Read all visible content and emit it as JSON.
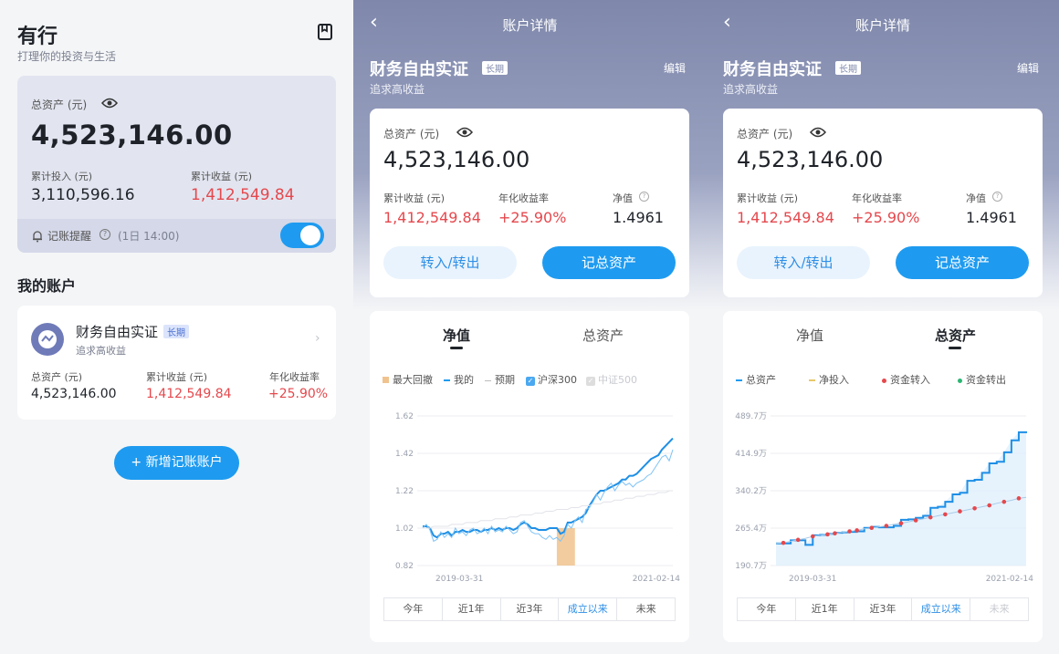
{
  "home": {
    "title": "有行",
    "subtitle": "打理你的投资与生活",
    "bookmark_icon": "bookmark-icon",
    "assets_label": "总资产 (元)",
    "assets_value": "4,523,146.00",
    "invest_label": "累计投入 (元)",
    "invest_value": "3,110,596.16",
    "income_label": "累计收益 (元)",
    "income_value": "1,412,549.84",
    "reminder_label": "记账提醒",
    "reminder_time": "(1日 14:00)",
    "reminder_on": true,
    "my_accounts": "我的账户",
    "account": {
      "name": "财务自由实证",
      "tag": "长期",
      "desc": "追求高收益",
      "assets_label": "总资产 (元)",
      "assets_value": "4,523,146.00",
      "income_label": "累计收益 (元)",
      "income_value": "1,412,549.84",
      "rate_label": "年化收益率",
      "rate_value": "+25.90%"
    },
    "add_button": "+ 新增记账账户"
  },
  "detail": {
    "nav_title": "账户详情",
    "account_name": "财务自由实证",
    "tag": "长期",
    "desc": "追求高收益",
    "edit": "编辑",
    "assets_label": "总资产 (元)",
    "assets_value": "4,523,146.00",
    "income_label": "累计收益 (元)",
    "income_value": "1,412,549.84",
    "rate_label": "年化收益率",
    "rate_value": "+25.90%",
    "nav_label": "净值",
    "nav_value": "1.4961",
    "transfer_button": "转入/转出",
    "record_button": "记总资产",
    "tab_nav": "净值",
    "tab_assets": "总资产",
    "ranges": [
      "今年",
      "近1年",
      "近3年",
      "成立以来",
      "未来"
    ]
  },
  "legend_nav": [
    "最大回撤",
    "我的",
    "预期",
    "沪深300",
    "中证500"
  ],
  "legend_assets": [
    "总资产",
    "净投入",
    "资金转入",
    "资金转出"
  ],
  "colors": {
    "accent": "#1e9bf0",
    "red": "#e5484d",
    "drawdown": "#f0c38e",
    "green": "#2bb673"
  },
  "chart_data": [
    {
      "type": "line",
      "title": "",
      "xlabel": "",
      "ylabel": "",
      "x_ticks": [
        "2019-03-31",
        "2021-02-14"
      ],
      "y_ticks": [
        "1.62",
        "1.42",
        "1.22",
        "1.02",
        "0.82"
      ],
      "ylim": [
        0.82,
        1.62
      ],
      "x": [
        0,
        1,
        2,
        3,
        4,
        5,
        6,
        7,
        8,
        9,
        10,
        11,
        12,
        13,
        14,
        15,
        16,
        17,
        18,
        19,
        20,
        21,
        22,
        23,
        24,
        25,
        26,
        27,
        28,
        29,
        30,
        31,
        32,
        33,
        34,
        35,
        36,
        37,
        38,
        39,
        40,
        41,
        42,
        43,
        44,
        45,
        46,
        47,
        48,
        49,
        50,
        51,
        52,
        53,
        54,
        55,
        56,
        57,
        58,
        59,
        60,
        61,
        62,
        63,
        64,
        65,
        66,
        67,
        68,
        69
      ],
      "series": [
        {
          "name": "我的",
          "values": [
            1.03,
            1.03,
            1.02,
            0.98,
            0.97,
            0.99,
            0.99,
            1.0,
            0.98,
            1.0,
            1.0,
            1.01,
            1.0,
            1.0,
            1.01,
            1.01,
            1.0,
            1.01,
            1.01,
            1.02,
            1.01,
            1.02,
            1.01,
            1.02,
            1.02,
            1.01,
            1.02,
            1.04,
            1.05,
            1.04,
            1.02,
            1.02,
            1.01,
            1.01,
            1.01,
            1.02,
            1.02,
            1.02,
            0.99,
            1.0,
            1.05,
            1.05,
            1.06,
            1.07,
            1.08,
            1.1,
            1.14,
            1.17,
            1.2,
            1.22,
            1.22,
            1.23,
            1.24,
            1.25,
            1.26,
            1.28,
            1.28,
            1.3,
            1.3,
            1.31,
            1.33,
            1.35,
            1.37,
            1.39,
            1.4,
            1.41,
            1.44,
            1.46,
            1.48,
            1.5
          ]
        },
        {
          "name": "沪深300",
          "values": [
            1.02,
            1.04,
            1.01,
            0.95,
            0.96,
            1.0,
            0.97,
            0.99,
            0.97,
            1.02,
            0.99,
            1.0,
            0.98,
            1.01,
            1.02,
            0.99,
            1.0,
            1.02,
            0.99,
            1.03,
            1.0,
            1.01,
            1.0,
            1.03,
            1.01,
            0.99,
            1.0,
            1.05,
            1.06,
            1.03,
            1.0,
            0.99,
            0.99,
            0.97,
            0.96,
            0.98,
            0.96,
            0.97,
            0.95,
            0.98,
            1.04,
            1.02,
            1.06,
            1.08,
            1.05,
            1.12,
            1.13,
            1.16,
            1.2,
            1.17,
            1.21,
            1.24,
            1.26,
            1.22,
            1.25,
            1.27,
            1.25,
            1.26,
            1.24,
            1.26,
            1.27,
            1.28,
            1.3,
            1.31,
            1.34,
            1.37,
            1.4,
            1.41,
            1.38,
            1.44
          ]
        },
        {
          "name": "预期",
          "values": [
            1.02,
            1.02,
            1.02,
            1.03,
            1.03,
            1.03,
            1.03,
            1.03,
            1.04,
            1.04,
            1.04,
            1.04,
            1.05,
            1.05,
            1.05,
            1.05,
            1.06,
            1.06,
            1.06,
            1.06,
            1.07,
            1.07,
            1.07,
            1.07,
            1.08,
            1.08,
            1.08,
            1.09,
            1.09,
            1.09,
            1.09,
            1.1,
            1.1,
            1.1,
            1.11,
            1.11,
            1.11,
            1.12,
            1.12,
            1.12,
            1.12,
            1.13,
            1.13,
            1.13,
            1.14,
            1.14,
            1.14,
            1.15,
            1.15,
            1.15,
            1.16,
            1.16,
            1.16,
            1.17,
            1.17,
            1.17,
            1.18,
            1.18,
            1.18,
            1.19,
            1.19,
            1.19,
            1.2,
            1.2,
            1.2,
            1.21,
            1.21,
            1.21,
            1.22,
            1.22
          ]
        }
      ],
      "drawdown_range": [
        37,
        42
      ]
    },
    {
      "type": "line",
      "title": "",
      "xlabel": "",
      "ylabel": "",
      "x_ticks": [
        "2019-03-31",
        "2021-02-14"
      ],
      "y_ticks": [
        "489.7万",
        "414.9万",
        "340.2万",
        "265.4万",
        "190.7万"
      ],
      "ylim": [
        190.7,
        489.7
      ],
      "x": [
        0,
        1,
        2,
        3,
        4,
        5,
        6,
        7,
        8,
        9,
        10,
        11,
        12,
        13,
        14,
        15,
        16,
        17,
        18,
        19,
        20,
        21,
        22,
        23,
        24,
        25,
        26,
        27,
        28,
        29,
        30,
        31,
        32,
        33,
        34
      ],
      "series": [
        {
          "name": "总资产",
          "values": [
            235,
            235,
            241,
            241,
            232,
            251,
            252,
            254,
            256,
            257,
            258,
            259,
            266,
            268,
            267,
            267,
            270,
            282,
            283,
            286,
            290,
            306,
            308,
            318,
            333,
            336,
            360,
            362,
            376,
            395,
            398,
            417,
            441,
            457,
            459
          ]
        },
        {
          "name": "净投入",
          "values": [
            235,
            236,
            239,
            242,
            245,
            249,
            251,
            253,
            255,
            257,
            259,
            261,
            264,
            266,
            268,
            270,
            273,
            275,
            278,
            281,
            284,
            287,
            290,
            293,
            296,
            299,
            302,
            305,
            308,
            311,
            315,
            318,
            321,
            325,
            327
          ]
        }
      ],
      "transfer_in_points": [
        1,
        3,
        5,
        7,
        8,
        10,
        11,
        13,
        15,
        17,
        19,
        21,
        23,
        25,
        27,
        29,
        31,
        33
      ]
    }
  ]
}
